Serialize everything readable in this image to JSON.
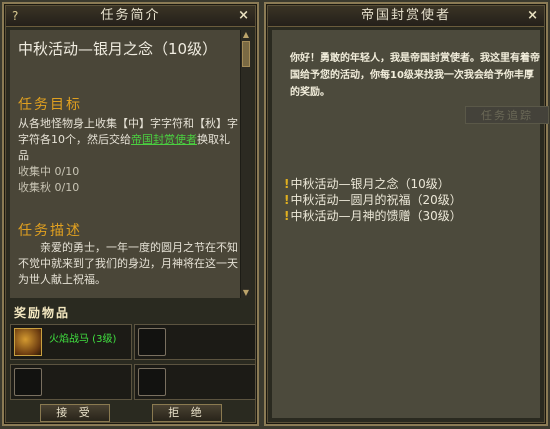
{
  "left_window": {
    "title": "任务简介",
    "help_glyph": "?",
    "close_glyph": "×",
    "quest_name": "中秋活动—银月之念（10级）",
    "objective_heading": "任务目标",
    "objective_pre": "从各地怪物身上收集【中】字字符和【秋】字字符各10个，然后交给",
    "objective_npc": "帝国封赏使者",
    "objective_post": "换取礼品",
    "progress_1": "收集中 0/10",
    "progress_2": "收集秋 0/10",
    "desc_heading": "任务描述",
    "description": "亲爱的勇士，一年一度的圆月之节在不知不觉中就来到了我们的身边，月神将在这一天为世人献上祝福。",
    "reward_heading": "奖励物品",
    "reward_item_name": "火焰战马 (3级)",
    "accept_label": "接 受",
    "reject_label": "拒 绝"
  },
  "right_window": {
    "title": "帝国封赏使者",
    "close_glyph": "×",
    "npc_speech": "你好！勇敢的年轻人，我是帝国封赏使者。我这里有着帝国给予您的活动，你每10级来找我一次我会给予你丰厚的奖励。",
    "ghost_button": "任务追踪",
    "quest_options": [
      "中秋活动—银月之念（10级）",
      "中秋活动—圆月的祝福（20级）",
      "中秋活动—月神的馈赠（30级）"
    ]
  },
  "colors": {
    "accent_orange": "#e0a020",
    "link_green": "#4ad040",
    "item_green": "#40e040"
  }
}
